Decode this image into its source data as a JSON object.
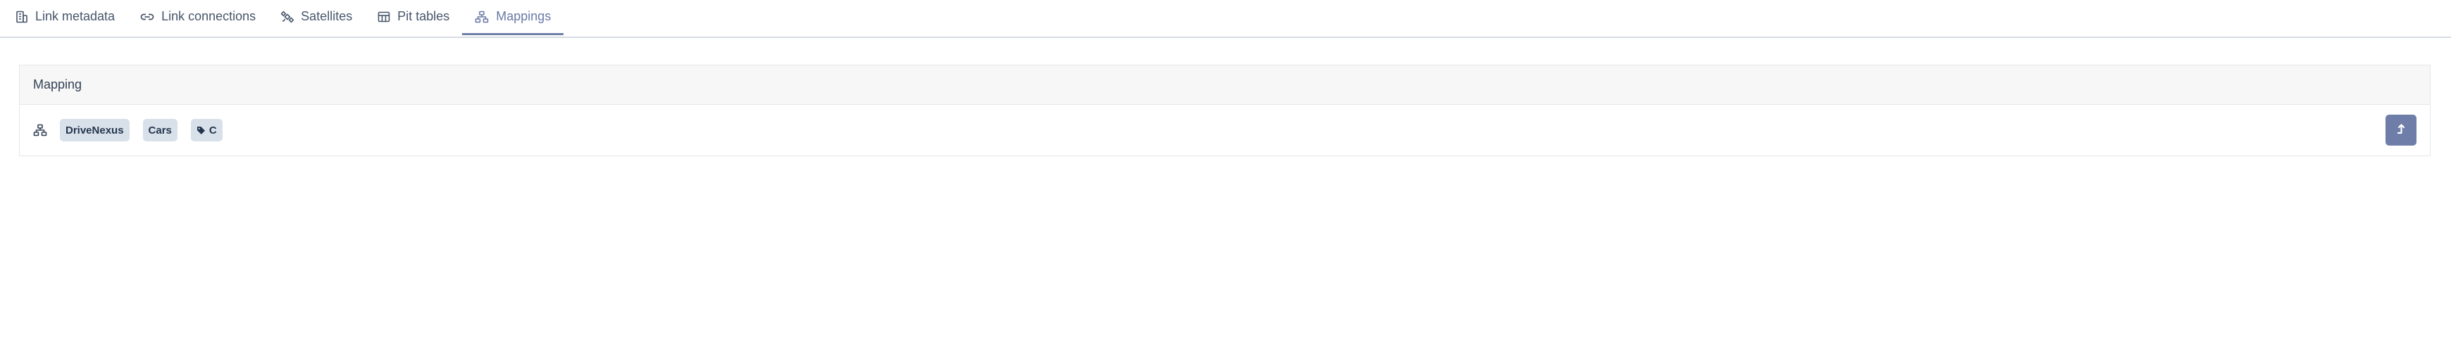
{
  "tabs": [
    {
      "label": "Link metadata",
      "icon": "building-icon",
      "active": false
    },
    {
      "label": "Link connections",
      "icon": "link-icon",
      "active": false
    },
    {
      "label": "Satellites",
      "icon": "satellite-icon",
      "active": false
    },
    {
      "label": "Pit tables",
      "icon": "table-icon",
      "active": false
    },
    {
      "label": "Mappings",
      "icon": "hierarchy-icon",
      "active": true
    }
  ],
  "panel": {
    "header": "Mapping",
    "rows": [
      {
        "icon": "hierarchy-icon",
        "chips": [
          "DriveNexus",
          "Cars"
        ],
        "tag_chip": {
          "icon": "tag-icon",
          "label": "C"
        },
        "action_icon": "level-up-icon"
      }
    ]
  },
  "colors": {
    "active_tab": "#6a7aa6",
    "chip_bg": "#d8e1ea",
    "button_bg": "#6f7ea8",
    "header_bg": "#f7f7f7"
  }
}
